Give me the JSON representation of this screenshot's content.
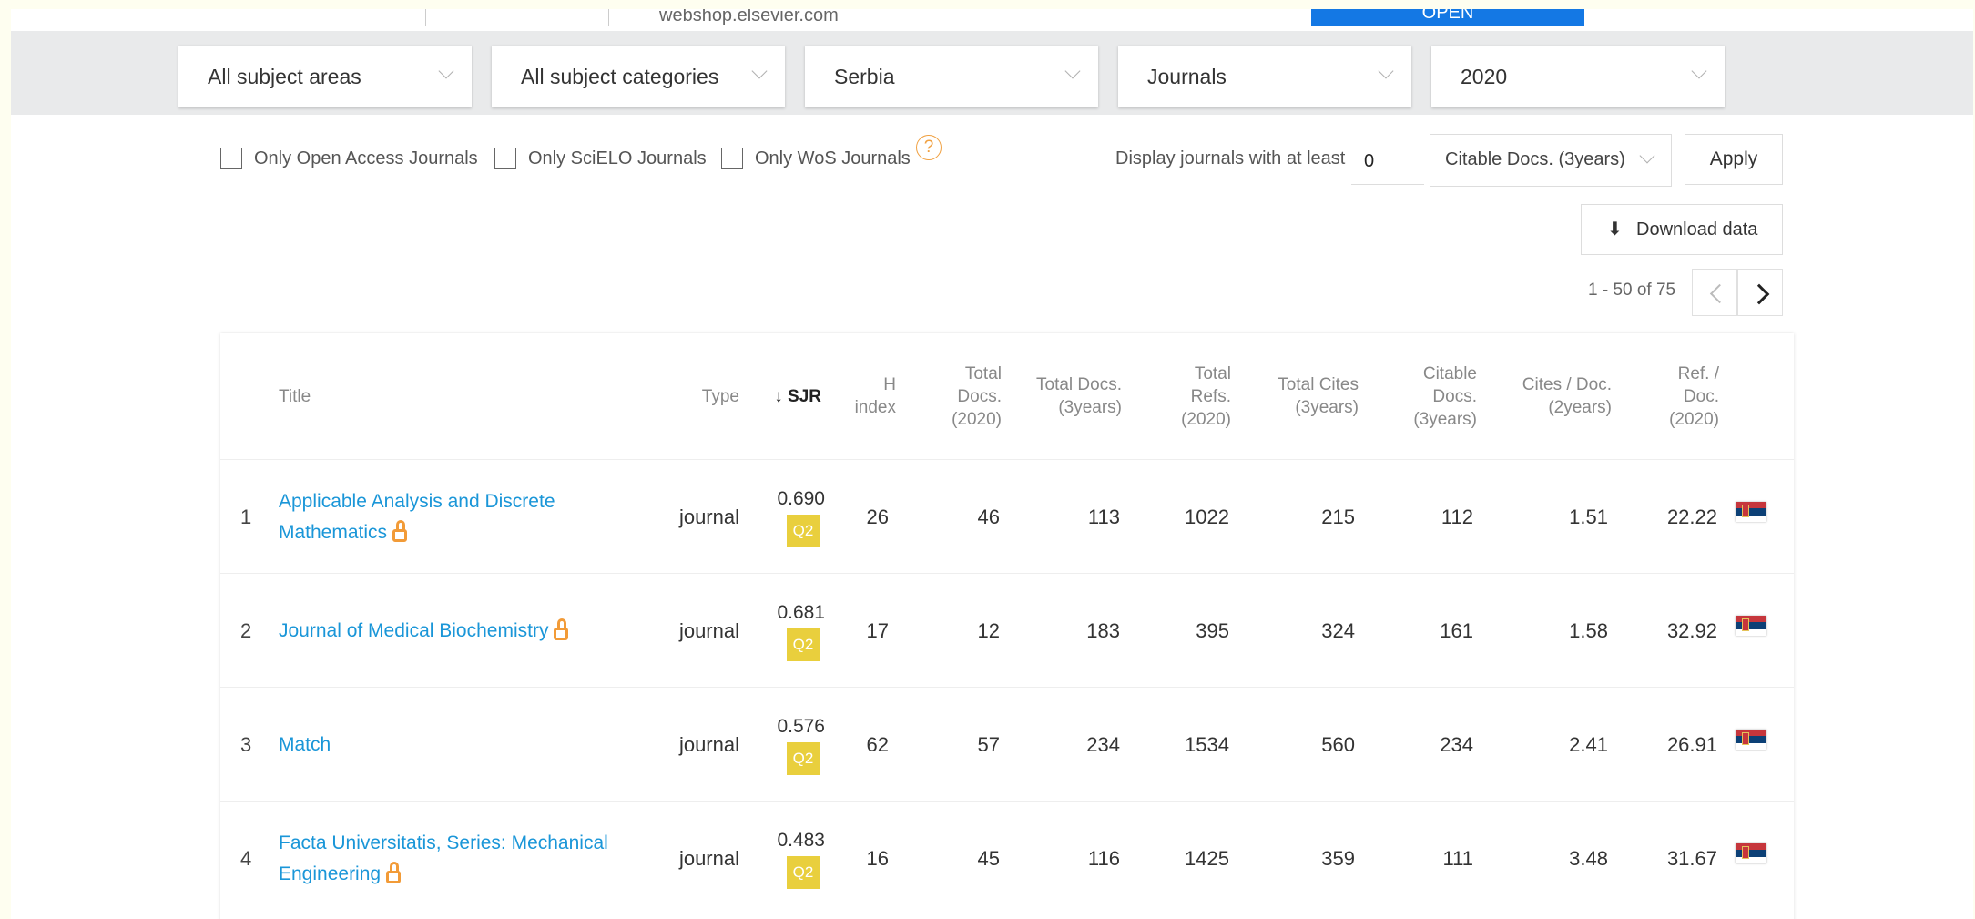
{
  "ad": {
    "url_text": "webshop.elsevier.com",
    "button_label": "OPEN"
  },
  "filters": {
    "subject_area": "All subject areas",
    "subject_category": "All subject categories",
    "country": "Serbia",
    "type": "Journals",
    "year": "2020"
  },
  "checkboxes": {
    "open_access": "Only Open Access Journals",
    "scielo": "Only SciELO Journals",
    "wos": "Only WoS Journals"
  },
  "help_icon_glyph": "?",
  "min_filter": {
    "label": "Display journals with at least",
    "value": "0",
    "metric": "Citable Docs. (3years)",
    "apply_label": "Apply"
  },
  "download": {
    "icon_glyph": "⬇",
    "label": "Download data"
  },
  "pagination": {
    "text": "1 - 50 of 75"
  },
  "table": {
    "headers": {
      "title": "Title",
      "type": "Type",
      "sjr": "↓ SJR",
      "h_index": [
        "H",
        "index"
      ],
      "total_docs_2020": [
        "Total",
        "Docs.",
        "(2020)"
      ],
      "total_docs_3y": [
        "Total Docs.",
        "(3years)"
      ],
      "total_refs": [
        "Total",
        "Refs.",
        "(2020)"
      ],
      "total_cites": [
        "Total Cites",
        "(3years)"
      ],
      "citable_docs": [
        "Citable",
        "Docs.",
        "(3years)"
      ],
      "cites_doc": [
        "Cites / Doc.",
        "(2years)"
      ],
      "ref_doc": [
        "Ref. /",
        "Doc.",
        "(2020)"
      ]
    },
    "rows": [
      {
        "rank": "1",
        "title": "Applicable Analysis and Discrete Mathematics",
        "open_access": true,
        "type": "journal",
        "sjr": "0.690",
        "quartile": "Q2",
        "h_index": "26",
        "total_docs_2020": "46",
        "total_docs_3y": "113",
        "total_refs": "1022",
        "total_cites": "215",
        "citable_docs": "112",
        "cites_doc": "1.51",
        "ref_doc": "22.22",
        "country_flag": "serbia-flag"
      },
      {
        "rank": "2",
        "title": "Journal of Medical Biochemistry",
        "open_access": true,
        "type": "journal",
        "sjr": "0.681",
        "quartile": "Q2",
        "h_index": "17",
        "total_docs_2020": "12",
        "total_docs_3y": "183",
        "total_refs": "395",
        "total_cites": "324",
        "citable_docs": "161",
        "cites_doc": "1.58",
        "ref_doc": "32.92",
        "country_flag": "serbia-flag"
      },
      {
        "rank": "3",
        "title": "Match",
        "open_access": false,
        "type": "journal",
        "sjr": "0.576",
        "quartile": "Q2",
        "h_index": "62",
        "total_docs_2020": "57",
        "total_docs_3y": "234",
        "total_refs": "1534",
        "total_cites": "560",
        "citable_docs": "234",
        "cites_doc": "2.41",
        "ref_doc": "26.91",
        "country_flag": "serbia-flag"
      },
      {
        "rank": "4",
        "title": "Facta Universitatis, Series: Mechanical Engineering",
        "open_access": true,
        "type": "journal",
        "sjr": "0.483",
        "quartile": "Q2",
        "h_index": "16",
        "total_docs_2020": "45",
        "total_docs_3y": "116",
        "total_refs": "1425",
        "total_cites": "359",
        "citable_docs": "111",
        "cites_doc": "3.48",
        "ref_doc": "31.67",
        "country_flag": "serbia-flag"
      }
    ]
  },
  "colors": {
    "link": "#1a96d8",
    "quartile_q2": "#e9cf3d",
    "open_access": "#f29b38",
    "filter_bar": "#e9eaeb",
    "ad_button": "#1478e4"
  }
}
